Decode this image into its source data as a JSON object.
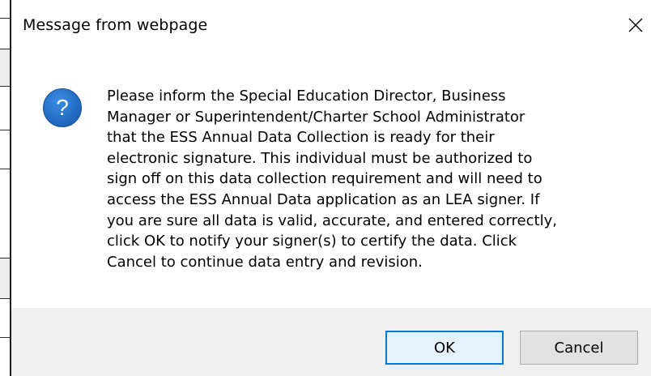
{
  "dialog": {
    "title": "Message from webpage",
    "message": "Please inform the Special Education Director, Business\nManager or Superintendent/Charter School Administrator\nthat the ESS Annual Data Collection is ready for their\nelectronic signature. This individual must be authorized to\nsign off on this data collection requirement and will need to\naccess the ESS Annual Data application as an LEA signer.   If\nyou are sure all data is valid, accurate, and entered correctly,\nclick OK to notify your signer(s) to certify the data. Click\nCancel to continue data entry and revision.",
    "icon": "question-icon",
    "ok_label": "OK",
    "cancel_label": "Cancel",
    "close_icon": "close-icon"
  },
  "colors": {
    "icon_blue": "#1e6fc9",
    "ok_border": "#0078d7",
    "button_bar": "#f0f0f0"
  }
}
